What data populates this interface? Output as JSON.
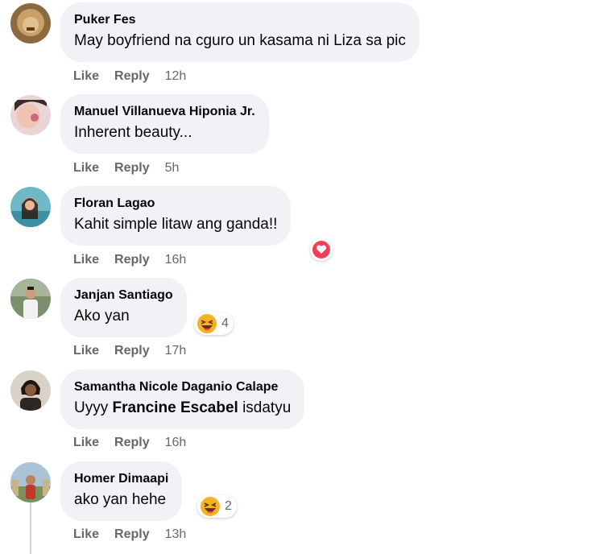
{
  "actions": {
    "like": "Like",
    "reply": "Reply"
  },
  "comments": [
    {
      "author": "Puker Fes",
      "text": "May boyfriend na cguro un kasama ni Liza sa pic",
      "time": "12h"
    },
    {
      "author": "Manuel Villanueva Hiponia Jr.",
      "text": "Inherent beauty...",
      "time": "5h"
    },
    {
      "author": "Floran Lagao",
      "text": "Kahit simple litaw ang ganda!!",
      "time": "16h",
      "reaction": "heart"
    },
    {
      "author": "Janjan Santiago",
      "text": "Ako yan",
      "time": "17h",
      "reaction": "haha",
      "reaction_count": "4"
    },
    {
      "author": "Samantha Nicole Daganio Calape",
      "text_before": "Uyyy ",
      "mention": "Francine Escabel",
      "text_after": " isdatyu",
      "time": "16h"
    },
    {
      "author": "Homer Dimaapi",
      "text": "ako yan hehe",
      "time": "13h",
      "reaction": "haha",
      "reaction_count": "2"
    }
  ],
  "colors": {
    "bubble": "#f0f2f5",
    "secondary_text": "#65676b",
    "heart_red": "#f33e58",
    "haha_yellow": "#f7b125"
  }
}
